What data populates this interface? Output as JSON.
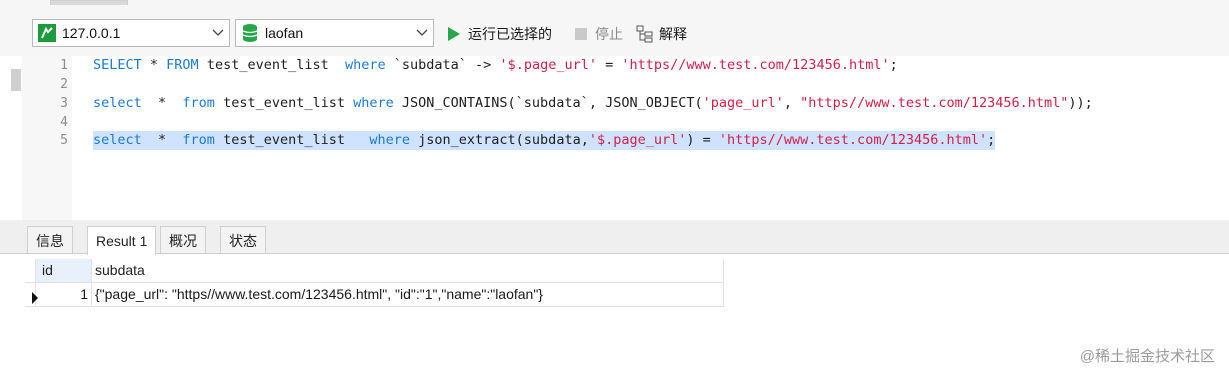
{
  "toolbar": {
    "connection": "127.0.0.1",
    "database": "laofan",
    "run_selected_label": "运行已选择的",
    "stop_label": "停止",
    "explain_label": "解释",
    "colors": {
      "accent_green": "#26a646",
      "connection_icon_green": "#1d9b3a"
    }
  },
  "editor": {
    "lines": [
      {
        "num": "1",
        "code": "SELECT * FROM test_event_list  where `subdata` -> '$.page_url' = 'https//www.test.com/123456.html';"
      },
      {
        "num": "2",
        "code": ""
      },
      {
        "num": "3",
        "code": "select  *  from test_event_list where JSON_CONTAINS(`subdata`, JSON_OBJECT('page_url', \"https//www.test.com/123456.html\"));"
      },
      {
        "num": "4",
        "code": ""
      },
      {
        "num": "5",
        "code": "select  *  from test_event_list   where json_extract(subdata,'$.page_url') = 'https//www.test.com/123456.html';"
      }
    ],
    "colors": {
      "keyword": "#1c7ad6",
      "string": "#d41f47",
      "selection": "#cfe3ff"
    }
  },
  "tabs": [
    "信息",
    "Result 1",
    "概况",
    "状态"
  ],
  "active_tab": "Result 1",
  "result": {
    "columns": [
      "id",
      "subdata"
    ],
    "rows": [
      {
        "id": "1",
        "subdata": "{\"page_url\": \"https//www.test.com/123456.html\", \"id\":\"1\",\"name\":\"laofan\"}"
      }
    ]
  },
  "watermark": "@稀土掘金技术社区"
}
